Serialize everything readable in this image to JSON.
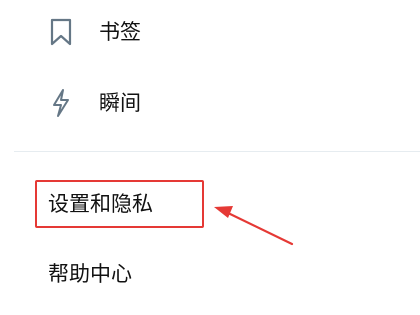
{
  "menu": {
    "items": [
      {
        "label": "书签",
        "icon": "bookmark-icon"
      },
      {
        "label": "瞬间",
        "icon": "lightning-icon"
      },
      {
        "label": "设置和隐私"
      },
      {
        "label": "帮助中心"
      }
    ]
  },
  "colors": {
    "text": "#111111",
    "icon": "#657786",
    "divider": "#e6ecf0",
    "annotation": "#e53935"
  }
}
